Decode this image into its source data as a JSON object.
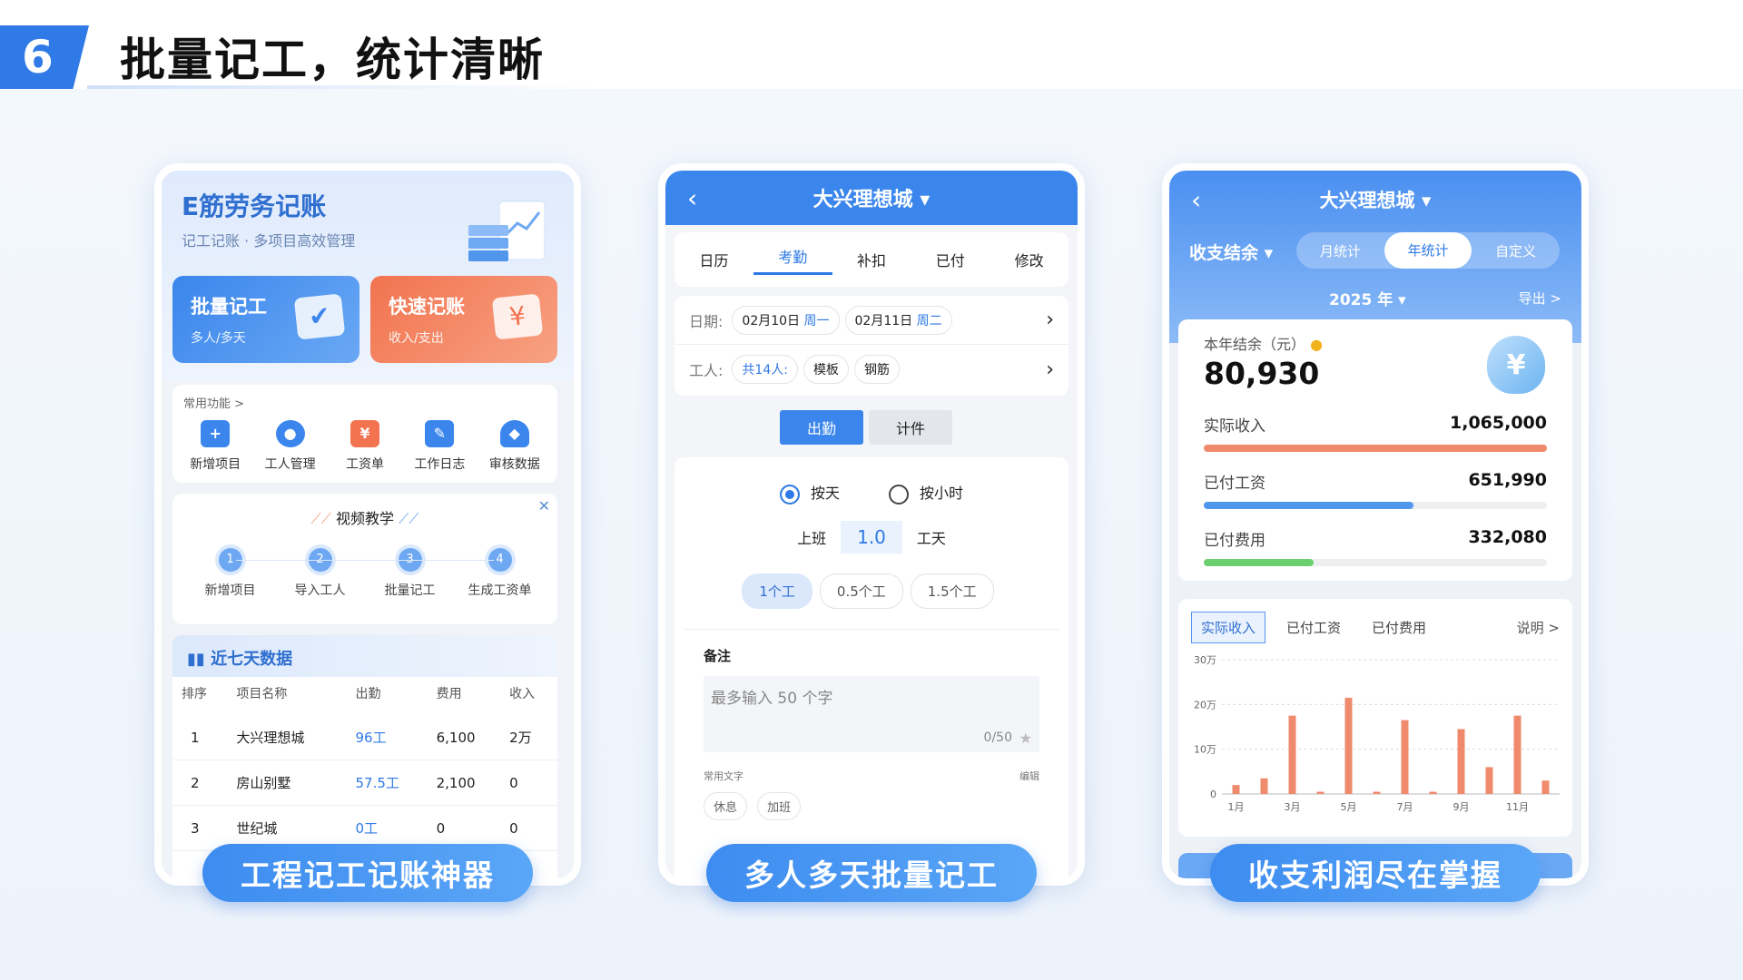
{
  "header": {
    "number": "6",
    "title": "批量记工，统计清晰"
  },
  "captions": [
    "工程记工记账神器",
    "多人多天批量记工",
    "收支利润尽在掌握"
  ],
  "p1": {
    "title": "E筋劳务记账",
    "subtitle": "记工记账 · 多项目高效管理",
    "btn1": {
      "title": "批量记工",
      "sub": "多人/多天"
    },
    "btn2": {
      "title": "快速记账",
      "sub": "收入/支出"
    },
    "common": "常用功能 >",
    "functions": [
      "新增项目",
      "工人管理",
      "工资单",
      "工作日志",
      "审核数据"
    ],
    "video": "视频教学",
    "steps": [
      {
        "n": "1",
        "label": "新增项目"
      },
      {
        "n": "2",
        "label": "导入工人"
      },
      {
        "n": "3",
        "label": "批量记工"
      },
      {
        "n": "4",
        "label": "生成工资单"
      }
    ],
    "table_title": "近七天数据",
    "cols": [
      "排序",
      "项目名称",
      "出勤",
      "费用",
      "收入"
    ],
    "rows": [
      [
        "1",
        "大兴理想城",
        "96工",
        "6,100",
        "2万"
      ],
      [
        "2",
        "房山别墅",
        "57.5工",
        "2,100",
        "0"
      ],
      [
        "3",
        "世纪城",
        "0工",
        "0",
        "0"
      ]
    ]
  },
  "p2": {
    "nav": "大兴理想城 ▾",
    "tabs": [
      "日历",
      "考勤",
      "补扣",
      "已付",
      "修改"
    ],
    "date_label": "日期:",
    "dates": [
      {
        "d": "02月10日",
        "w": "周一"
      },
      {
        "d": "02月11日",
        "w": "周二"
      }
    ],
    "worker_label": "工人:",
    "workers": [
      "共14人:",
      "模板",
      "钢筋"
    ],
    "mode": [
      "出勤",
      "计件"
    ],
    "radio": [
      "按天",
      "按小时"
    ],
    "shift": "上班",
    "shift_val": "1.0",
    "shift_unit": "工天",
    "options": [
      "1个工",
      "0.5个工",
      "1.5个工"
    ],
    "note_title": "备注",
    "note_placeholder": "最多输入 50 个字",
    "note_count": "0/50",
    "common_text": "常用文字",
    "edit": "编辑",
    "tags": [
      "休息",
      "加班"
    ]
  },
  "p3": {
    "nav": "大兴理想城 ▾",
    "balance": "收支结余 ▾",
    "seg": [
      "月统计",
      "年统计",
      "自定义"
    ],
    "year": "2025 年 ▾",
    "export": "导出 >",
    "year_label": "本年结余（元）",
    "year_value": "80,930",
    "items": [
      {
        "label": "实际收入",
        "value": "1,065,000",
        "fraction": 1.0,
        "color": "#f08a6c"
      },
      {
        "label": "已付工资",
        "value": "651,990",
        "fraction": 0.61,
        "color": "#4f96ec"
      },
      {
        "label": "已付费用",
        "value": "332,080",
        "fraction": 0.32,
        "color": "#6bcf70"
      }
    ],
    "chart_tabs": [
      "实际收入",
      "已付工资",
      "已付费用"
    ],
    "explain": "说明 >"
  },
  "chart_data": {
    "type": "bar",
    "title": "",
    "categories": [
      "1月",
      "2月",
      "3月",
      "4月",
      "5月",
      "6月",
      "7月",
      "8月",
      "9月",
      "10月",
      "11月",
      "12月"
    ],
    "x_tick_labels": [
      "1月",
      "3月",
      "5月",
      "7月",
      "9月",
      "11月"
    ],
    "y_ticks": [
      "0",
      "10万",
      "20万",
      "30万"
    ],
    "ylim": [
      0,
      300000
    ],
    "series": [
      {
        "name": "实际收入",
        "values": [
          20000,
          35000,
          175000,
          5000,
          215000,
          5000,
          165000,
          5000,
          145000,
          60000,
          175000,
          30000
        ],
        "color": "#f08a6c"
      }
    ]
  }
}
